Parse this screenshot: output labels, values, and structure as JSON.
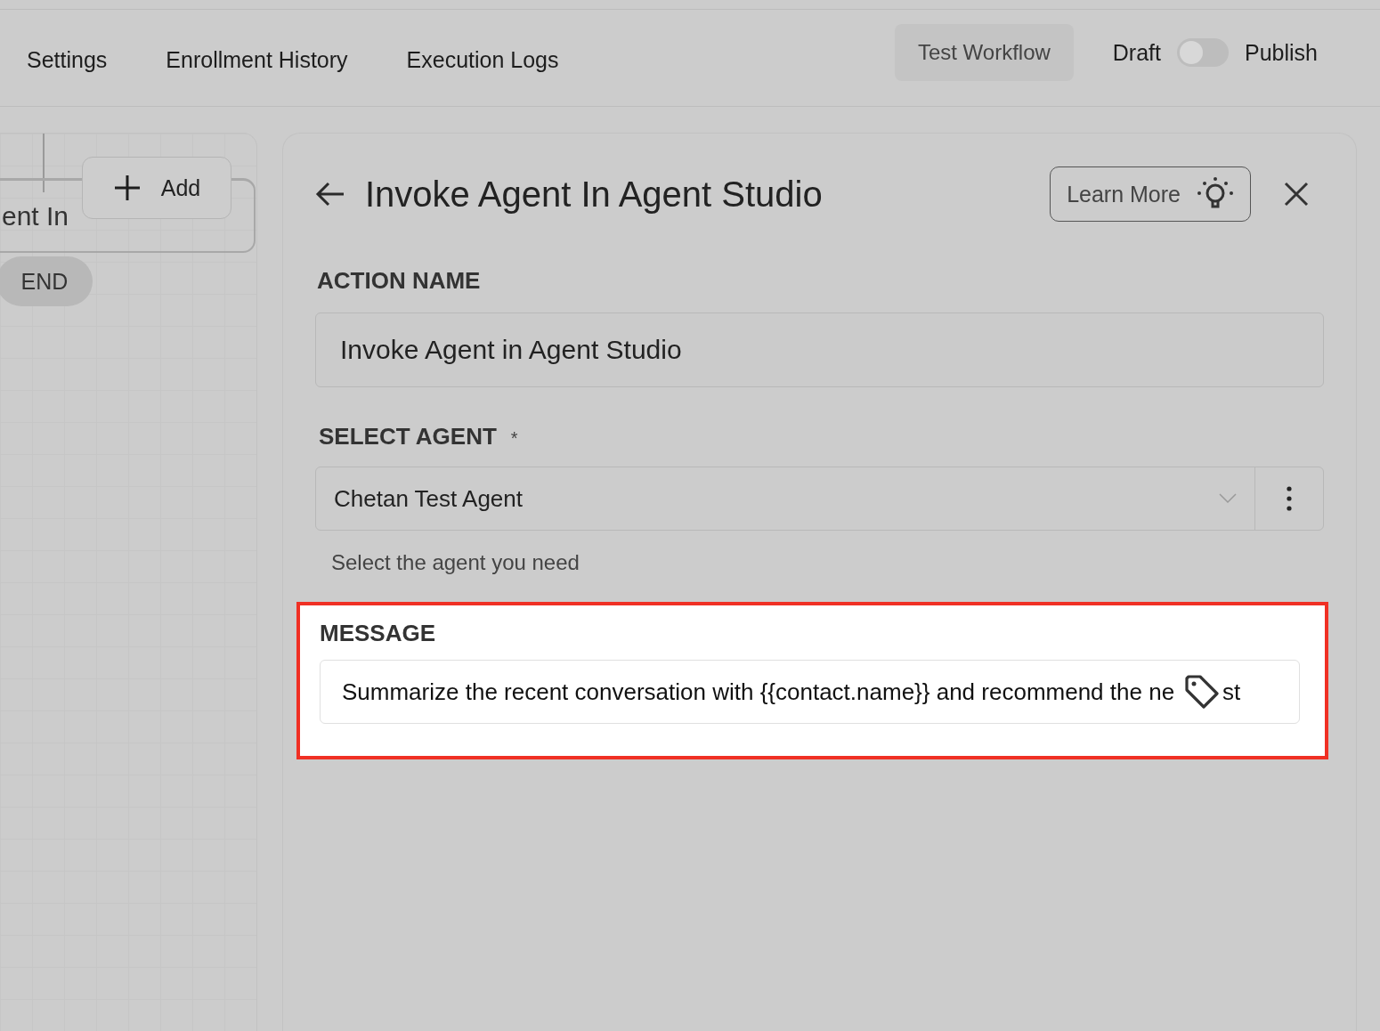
{
  "tabs": [
    {
      "label": "Settings",
      "selected": false
    },
    {
      "label": "Enrollment History",
      "selected": false
    },
    {
      "label": "Execution Logs",
      "selected": false
    }
  ],
  "test_button": "Test Workflow",
  "publish_toggle": {
    "off_label": "Draft",
    "on_label": "Publish",
    "on": false
  },
  "canvas": {
    "node_title": "ent In",
    "add_button": "Add",
    "end_badge": "END"
  },
  "panel": {
    "title": "Invoke Agent In Agent Studio",
    "learn_more": "Learn More",
    "action_name": {
      "label": "ACTION NAME",
      "value": "Invoke Agent in Agent Studio"
    },
    "select_agent": {
      "label": "SELECT AGENT",
      "required_mark": "*",
      "value": "Chetan Test Agent",
      "hint": "Select the agent you need"
    },
    "message": {
      "label": "MESSAGE",
      "value": "Summarize the recent conversation with {{contact.name}} and recommend the ne",
      "tail": "st",
      "highlighted": true
    }
  }
}
